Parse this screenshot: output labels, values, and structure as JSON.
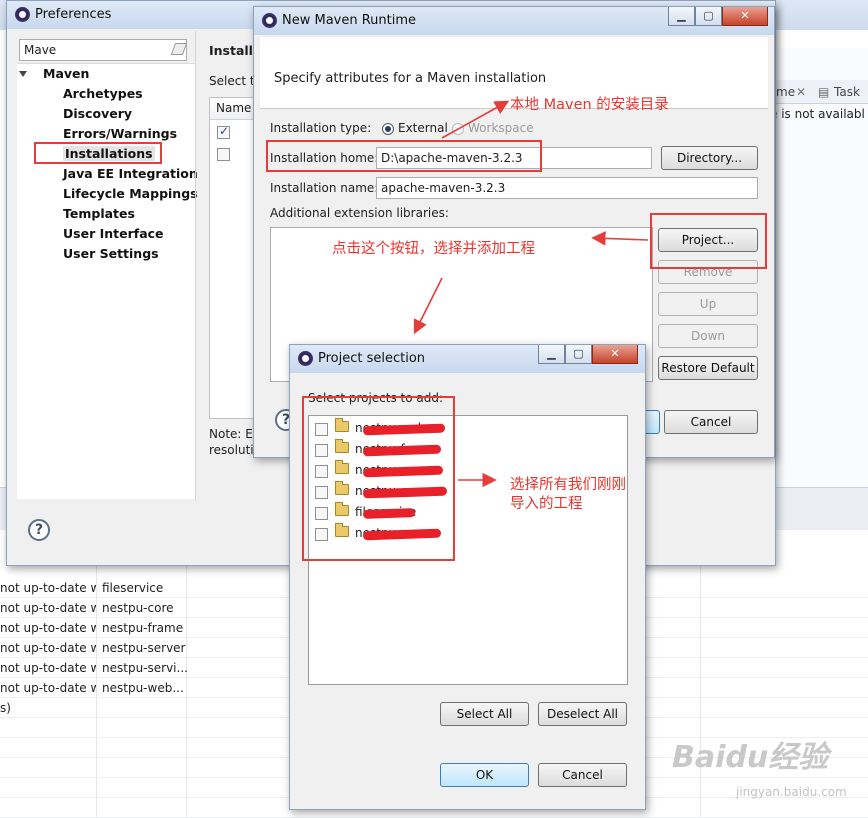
{
  "background": {
    "right_tabs": [
      "me",
      "Task"
    ],
    "right_message": "e is not availabl",
    "table_rows": [
      {
        "status": "not up-to-date w",
        "name": "fileservice"
      },
      {
        "status": "not up-to-date w",
        "name": "nestpu-core"
      },
      {
        "status": "not up-to-date w",
        "name": "nestpu-frame"
      },
      {
        "status": "not up-to-date w",
        "name": "nestpu-server"
      },
      {
        "status": "not up-to-date w",
        "name": "nestpu-servi..."
      },
      {
        "status": "not up-to-date w",
        "name": "nestpu-web..."
      },
      {
        "status": "s)",
        "name": ""
      }
    ]
  },
  "preferences": {
    "title": "Preferences",
    "filter_value": "Mave",
    "tree": {
      "root": "Maven",
      "children": [
        "Archetypes",
        "Discovery",
        "Errors/Warnings",
        "Installations",
        "Java EE Integration",
        "Lifecycle Mappings",
        "Templates",
        "User Interface",
        "User Settings"
      ],
      "selected": "Installations"
    },
    "page_title": "Installa",
    "select_text": "Select t",
    "table_header": "Name",
    "note_line1": "Note: E",
    "note_line2": "resoluti"
  },
  "new_maven_runtime": {
    "title": "New Maven Runtime",
    "subtitle": "Specify attributes for a Maven installation",
    "installation_type_label": "Installation type:",
    "type_options": [
      "External",
      "Workspace"
    ],
    "selected_type": "External",
    "home_label": "Installation home:",
    "home_value": "D:\\apache-maven-3.2.3",
    "directory_button": "Directory...",
    "name_label": "Installation name:",
    "name_value": "apache-maven-3.2.3",
    "ext_libs_label": "Additional extension libraries:",
    "buttons": {
      "project": "Project...",
      "remove": "Remove",
      "up": "Up",
      "down": "Down",
      "restore": "Restore Default",
      "cancel": "Cancel"
    }
  },
  "project_selection": {
    "title": "Project selection",
    "prompt": "Select projects to add:",
    "projects": [
      "nestpu-web...",
      "nestpu-f...",
      "nestpu-...",
      "nestpu-core",
      "fileservice",
      "nestpu-..."
    ],
    "buttons": {
      "select_all": "Select All",
      "deselect_all": "Deselect All",
      "ok": "OK",
      "cancel": "Cancel"
    }
  },
  "annotations": {
    "maven_home": "本地 Maven 的安装目录",
    "project_button": "点击这个按钮，选择并添加工程",
    "select_projects_line1": "选择所有我们刚刚",
    "select_projects_line2": "导入的工程",
    "color": "#e8352e"
  },
  "watermark": {
    "logo": "Baidu经验",
    "url": "jingyan.baidu.com"
  }
}
